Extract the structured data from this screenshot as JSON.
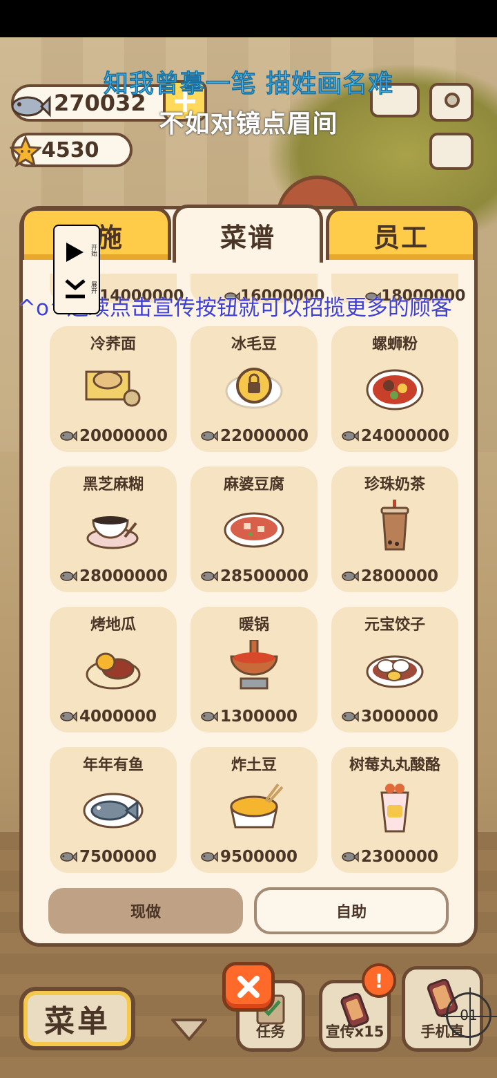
{
  "lyrics": {
    "line1": "知我曾摹一笔 描姓画名难",
    "line2": "不如对镜点眉间"
  },
  "currency": {
    "fish": "270032",
    "stars": "4530",
    "plus_label": "+"
  },
  "tabs": [
    {
      "label": "设施",
      "active": false
    },
    {
      "label": "菜谱",
      "active": true
    },
    {
      "label": "员工",
      "active": false
    }
  ],
  "partial_prices": [
    "14000000",
    "16000000",
    "18000000"
  ],
  "recipes": [
    {
      "name": "冷荞面",
      "price": "20000000",
      "icon": "cold-noodles-icon"
    },
    {
      "name": "冰毛豆",
      "price": "22000000",
      "icon": "locked-padlock-icon"
    },
    {
      "name": "螺蛳粉",
      "price": "24000000",
      "icon": "snail-noodles-icon"
    },
    {
      "name": "黑芝麻糊",
      "price": "28000000",
      "icon": "sesame-paste-icon"
    },
    {
      "name": "麻婆豆腐",
      "price": "28500000",
      "icon": "mapo-tofu-icon"
    },
    {
      "name": "珍珠奶茶",
      "price": "2800000",
      "icon": "bubble-tea-icon"
    },
    {
      "name": "烤地瓜",
      "price": "4000000",
      "icon": "sweet-potato-icon"
    },
    {
      "name": "暖锅",
      "price": "1300000",
      "icon": "hot-pot-icon"
    },
    {
      "name": "元宝饺子",
      "price": "3000000",
      "icon": "dumplings-icon"
    },
    {
      "name": "年年有鱼",
      "price": "7500000",
      "icon": "fish-dish-icon"
    },
    {
      "name": "炸土豆",
      "price": "9500000",
      "icon": "fried-potato-icon"
    },
    {
      "name": "树莓丸丸酸酪",
      "price": "2300000",
      "icon": "raspberry-yogurt-icon"
    }
  ],
  "actions": {
    "make_now": "现做",
    "self_service": "自助"
  },
  "tip": "^o^连续点击宣传按钮就可以招揽更多的顾客",
  "widget": {
    "play_label": "开始",
    "expand_label": "展开"
  },
  "bottom_bar": {
    "menu": "菜单",
    "task": "任务",
    "promo": "宣传x15",
    "phone": "手机直",
    "alert": "!",
    "crosshair": "01"
  },
  "colors": {
    "accent_tab": "#ffcc4a",
    "panel_bg": "#fdf4e6",
    "card_bg": "#f6e3c2",
    "outline": "#6b4a33",
    "close": "#ff6a2a",
    "lyric_blue": "#4cc2f0",
    "tip_blue": "#3f3fd8"
  }
}
